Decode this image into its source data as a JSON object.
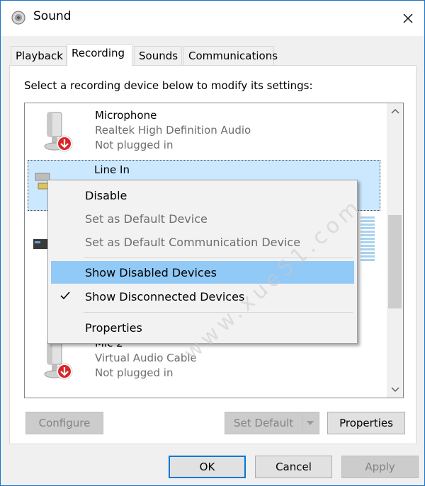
{
  "window": {
    "title": "Sound"
  },
  "tabs": [
    {
      "label": "Playback"
    },
    {
      "label": "Recording"
    },
    {
      "label": "Sounds"
    },
    {
      "label": "Communications"
    }
  ],
  "instruction": "Select a recording device below to modify its settings:",
  "devices": [
    {
      "name": "Microphone",
      "driver": "Realtek High Definition Audio",
      "status": "Not plugged in"
    },
    {
      "name": "Line In",
      "driver": "",
      "status": ""
    },
    {
      "name": "Mic 2",
      "driver": "Virtual Audio Cable",
      "status": "Not plugged in"
    }
  ],
  "context_menu": {
    "items": [
      {
        "label": "Disable"
      },
      {
        "label": "Set as Default Device"
      },
      {
        "label": "Set as Default Communication Device"
      },
      {
        "label": "Show Disabled Devices"
      },
      {
        "label": "Show Disconnected Devices"
      },
      {
        "label": "Properties"
      }
    ]
  },
  "panel_buttons": {
    "configure": "Configure",
    "set_default": "Set Default",
    "properties": "Properties"
  },
  "dialog_buttons": {
    "ok": "OK",
    "cancel": "Cancel",
    "apply": "Apply"
  },
  "watermark_text": "www.xue51.com",
  "colors": {
    "accent": "#0078d7",
    "menu_highlight": "#91c9f7",
    "selection": "#cce8ff",
    "unplugged_badge": "#d9262b"
  }
}
